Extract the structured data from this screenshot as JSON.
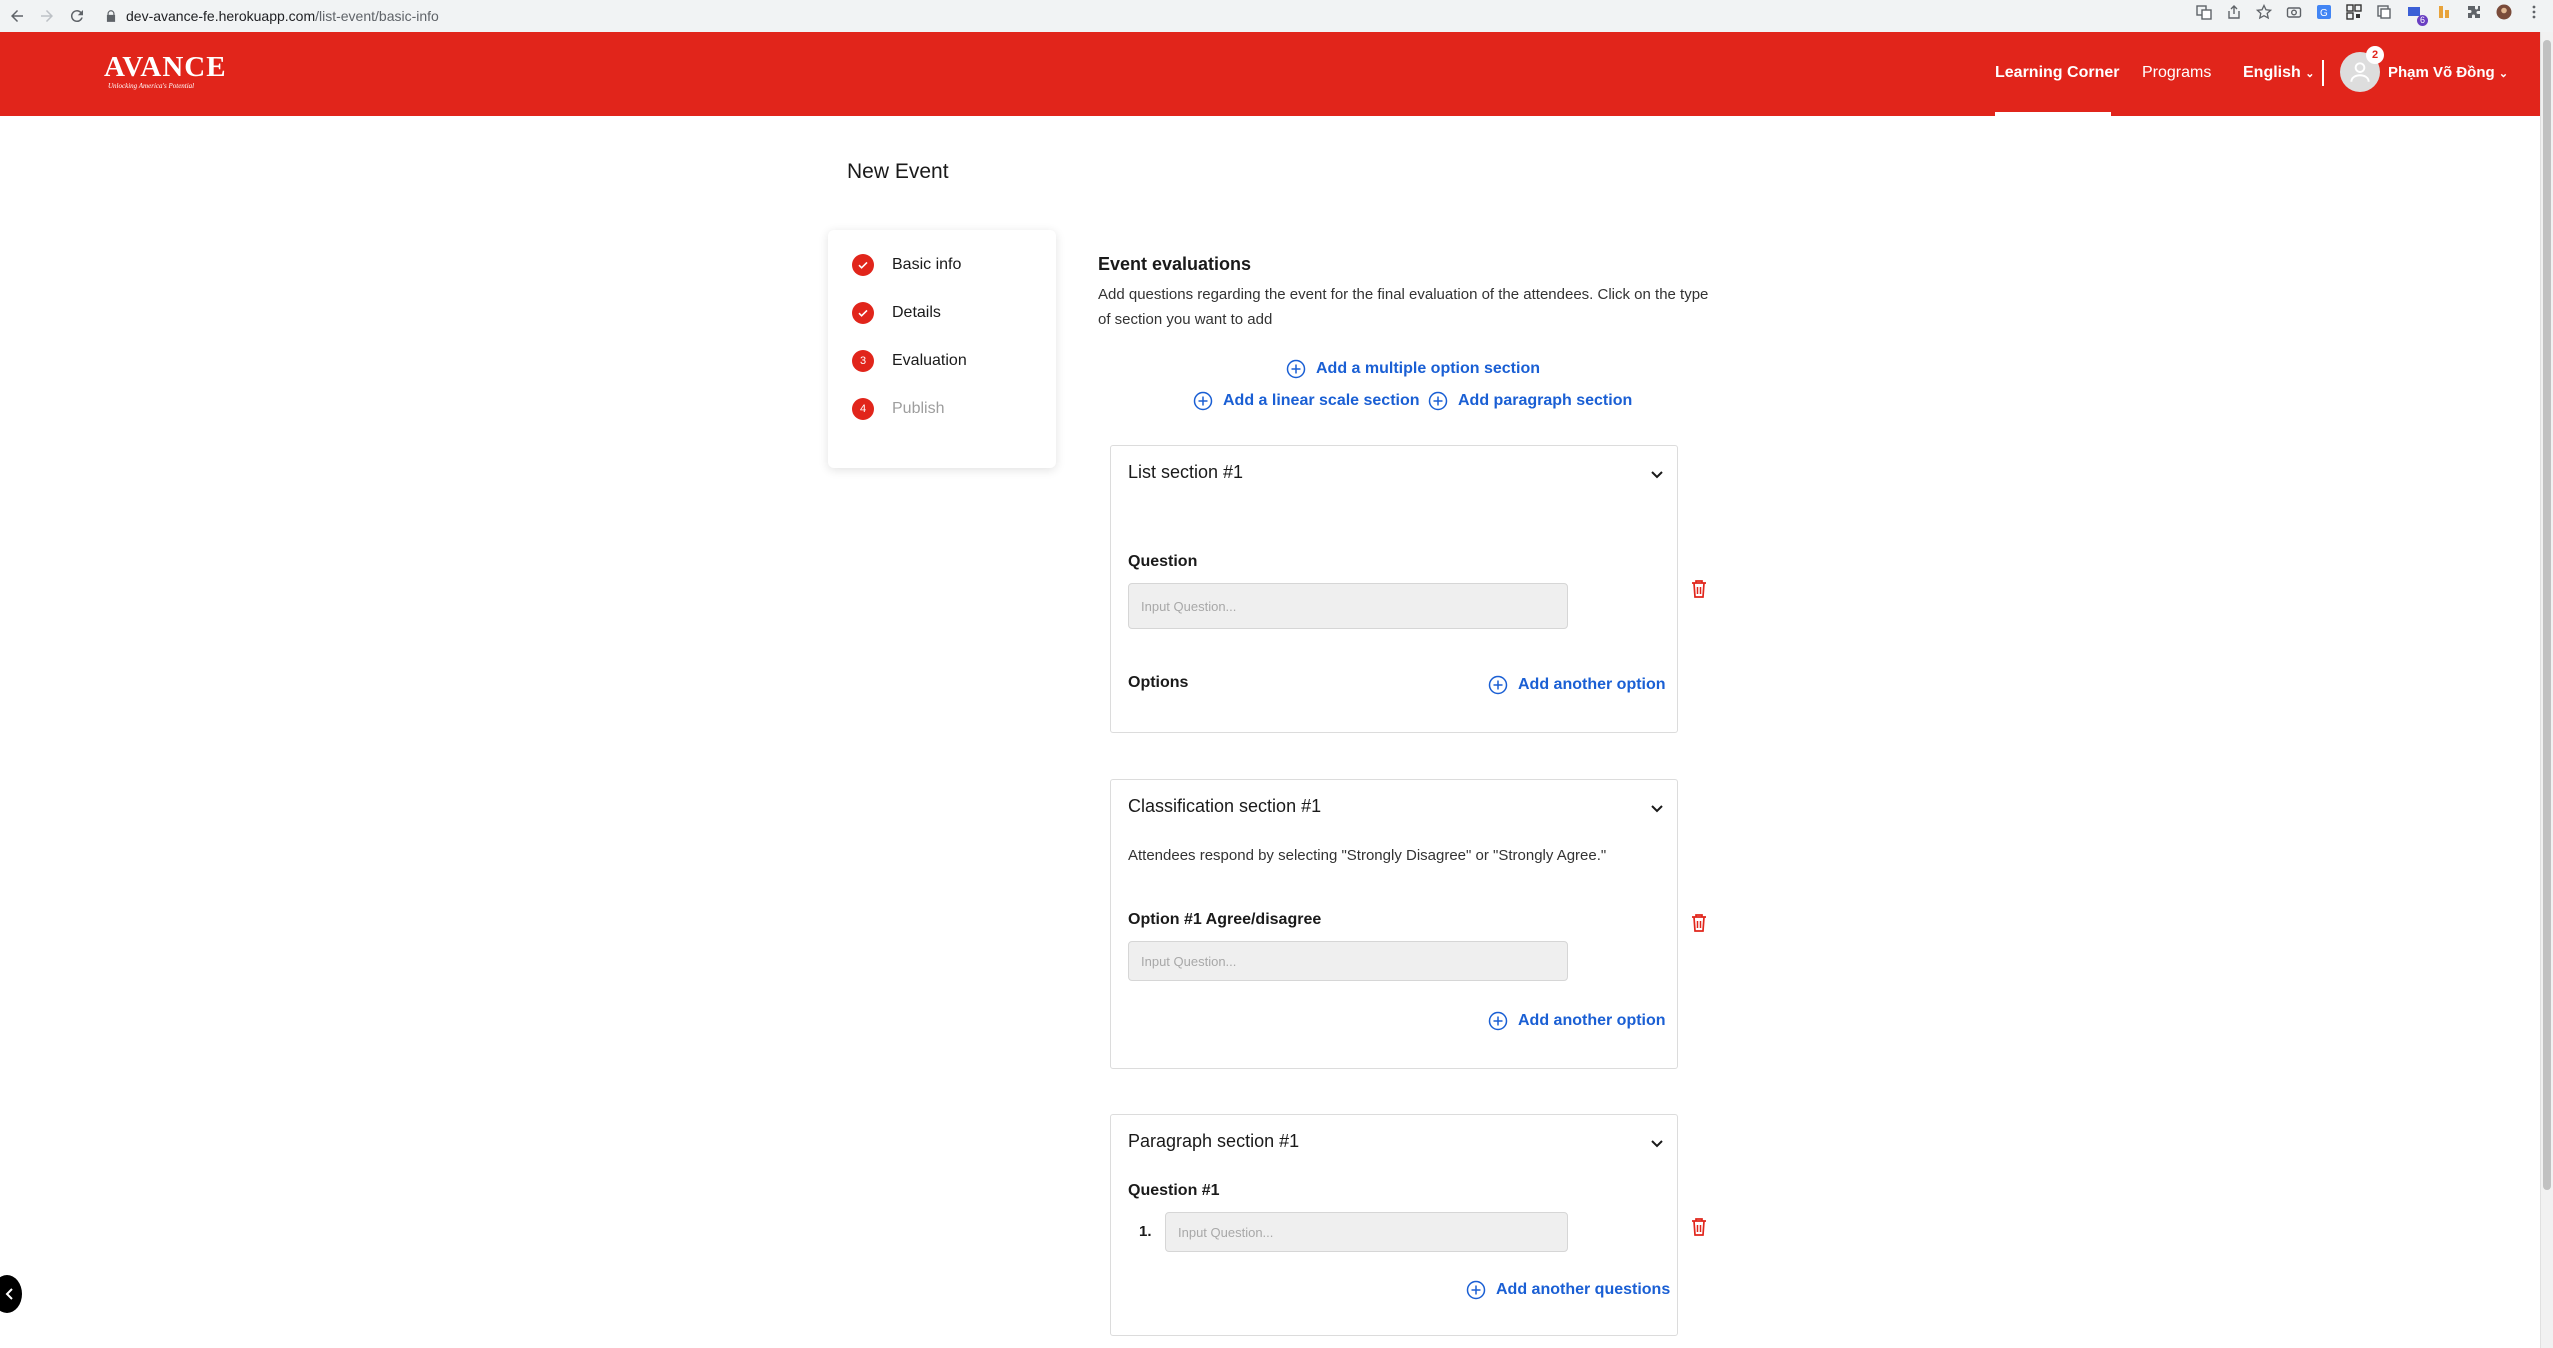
{
  "browser": {
    "url_host": "dev-avance-fe.herokuapp.com",
    "url_path": "/list-event/basic-info",
    "ext_badge": "6"
  },
  "header": {
    "logo_main": "AVANCE",
    "logo_sub": "Unlocking America's Potential",
    "nav": {
      "learning": "Learning Corner",
      "programs": "Programs",
      "language": "English"
    },
    "notification_count": "2",
    "user_name": "Phạm Võ Đồng",
    "brand_color": "#e1251b"
  },
  "page": {
    "title": "New Event"
  },
  "stepper": {
    "steps": [
      {
        "label": "Basic info",
        "state": "done",
        "marker": ""
      },
      {
        "label": "Details",
        "state": "done",
        "marker": ""
      },
      {
        "label": "Evaluation",
        "state": "current",
        "marker": "3"
      },
      {
        "label": "Publish",
        "state": "pending",
        "marker": "4"
      }
    ]
  },
  "evaluations": {
    "title": "Event evaluations",
    "description": "Add questions regarding the event for the final evaluation of the attendees. Click on the type of section you want to add",
    "add_multiple": "Add a multiple option section",
    "add_linear": "Add a linear scale section",
    "add_paragraph": "Add paragraph section"
  },
  "list_section": {
    "title": "List section #1",
    "question_label": "Question",
    "question_placeholder": "Input Question...",
    "options_label": "Options",
    "add_option": "Add another option"
  },
  "classification_section": {
    "title": "Classification section #1",
    "note": "Attendees respond by selecting \"Strongly Disagree\" or \"Strongly Agree.\"",
    "option_label": "Option #1 Agree/disagree",
    "option_placeholder": "Input Question...",
    "add_option": "Add another option"
  },
  "paragraph_section": {
    "title": "Paragraph section #1",
    "question_label": "Question #1",
    "question_number": "1.",
    "question_placeholder": "Input Question...",
    "add_question": "Add another questions"
  }
}
